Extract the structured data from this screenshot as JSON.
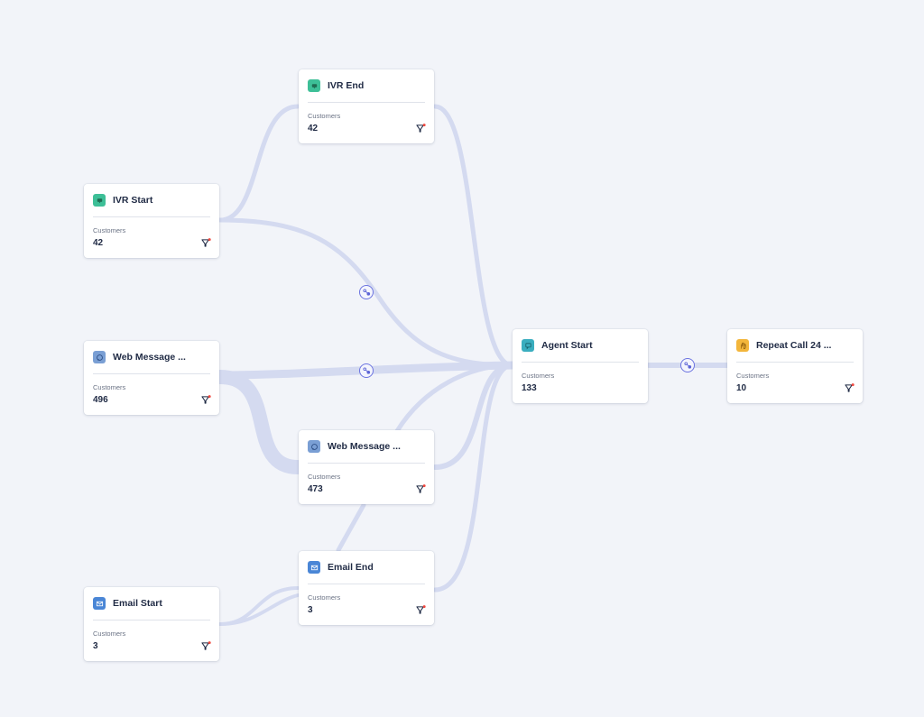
{
  "colors": {
    "background": "#f2f4f9",
    "flow": "#d4daf0",
    "badge_border": "#6c74e0",
    "filter_dot": "#f0483e"
  },
  "nodes": {
    "ivr_start": {
      "title": "IVR Start",
      "metric_label": "Customers",
      "value": "42",
      "icon": "ivr-icon",
      "icon_color": "#3dbf97",
      "has_filter": true
    },
    "web_msg_start": {
      "title": "Web Message ...",
      "metric_label": "Customers",
      "value": "496",
      "icon": "message-icon",
      "icon_color": "#7a9fd4",
      "has_filter": true
    },
    "email_start": {
      "title": "Email Start",
      "metric_label": "Customers",
      "value": "3",
      "icon": "email-icon",
      "icon_color": "#4a86d6",
      "has_filter": true
    },
    "ivr_end": {
      "title": "IVR End",
      "metric_label": "Customers",
      "value": "42",
      "icon": "ivr-icon",
      "icon_color": "#3dbf97",
      "has_filter": true
    },
    "web_msg_end": {
      "title": "Web Message ...",
      "metric_label": "Customers",
      "value": "473",
      "icon": "message-icon",
      "icon_color": "#7a9fd4",
      "has_filter": true
    },
    "email_end": {
      "title": "Email End",
      "metric_label": "Customers",
      "value": "3",
      "icon": "email-icon",
      "icon_color": "#4a86d6",
      "has_filter": true
    },
    "agent_start": {
      "title": "Agent Start",
      "metric_label": "Customers",
      "value": "133",
      "icon": "chat-icon",
      "icon_color": "#3aaebf",
      "has_filter": false
    },
    "repeat_call": {
      "title": "Repeat Call 24 ...",
      "metric_label": "Customers",
      "value": "10",
      "icon": "phone-hand-icon",
      "icon_color": "#f3b63b",
      "has_filter": true
    }
  },
  "links": [
    {
      "from": "ivr_start",
      "to": "ivr_end"
    },
    {
      "from": "ivr_start",
      "to": "agent_start",
      "badge": true
    },
    {
      "from": "web_msg_start",
      "to": "agent_start",
      "badge": true
    },
    {
      "from": "web_msg_start",
      "to": "web_msg_end"
    },
    {
      "from": "email_start",
      "to": "email_end"
    },
    {
      "from": "ivr_end",
      "to": "agent_start"
    },
    {
      "from": "web_msg_end",
      "to": "agent_start"
    },
    {
      "from": "email_end",
      "to": "agent_start"
    },
    {
      "from": "agent_start",
      "to": "repeat_call",
      "badge": true
    }
  ]
}
